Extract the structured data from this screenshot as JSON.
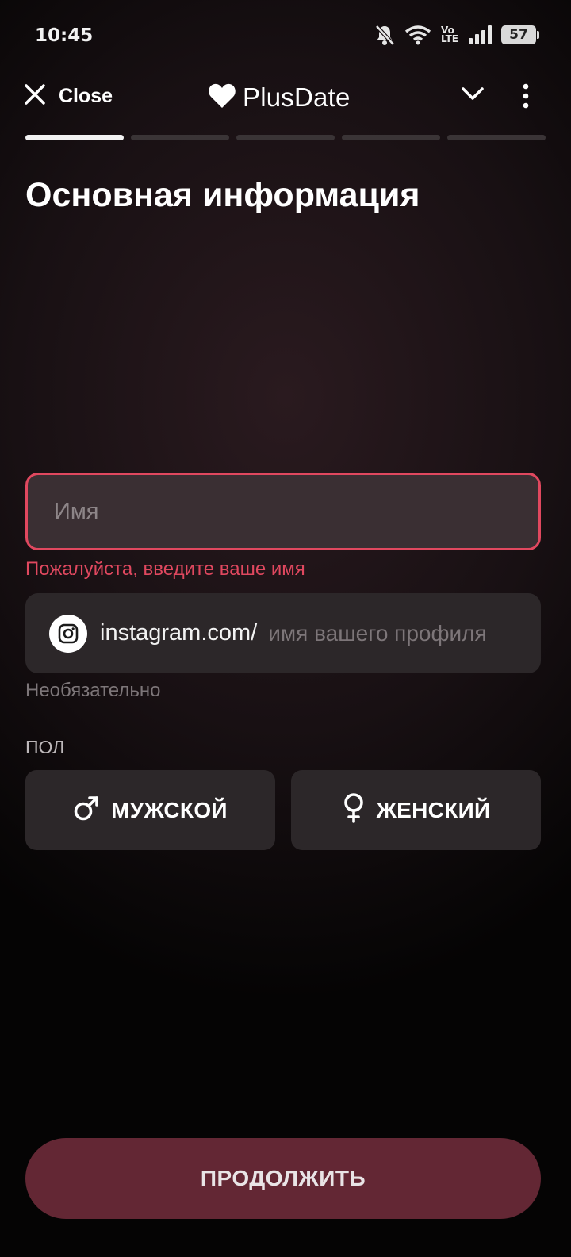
{
  "status_bar": {
    "time": "10:45",
    "icons": [
      "bell-muted-icon",
      "wifi-icon",
      "volte-icon",
      "signal-icon",
      "battery-icon"
    ],
    "volte_line1": "Vo",
    "volte_line2": "LTE",
    "battery_level": "57"
  },
  "nav": {
    "close_label": "Close",
    "brand_name": "PlusDate",
    "icons": {
      "close": "close-icon",
      "brand": "heart-logo-icon",
      "collapse": "chevron-down-icon",
      "menu": "more-vertical-icon"
    }
  },
  "progress": {
    "total_steps": 5,
    "current_step": 1
  },
  "page": {
    "title": "Основная информация"
  },
  "form": {
    "name_placeholder": "Имя",
    "name_value": "",
    "name_error": "Пожалуйста, введите ваше имя",
    "instagram_prefix": "instagram.com/",
    "instagram_placeholder": "имя вашего профиля",
    "instagram_value": "",
    "instagram_hint": "Необязательно",
    "gender_label": "ПОЛ",
    "gender_options": [
      {
        "label": "МУЖСКОЙ",
        "icon": "male-symbol-icon"
      },
      {
        "label": "ЖЕНСКИЙ",
        "icon": "female-symbol-icon"
      }
    ]
  },
  "footer": {
    "continue_label": "ПРОДОЛЖИТЬ"
  },
  "colors": {
    "error": "#e0485f",
    "field_bg": "#2c2729",
    "button_bg": "#632734",
    "progress_active": "#f2f2f2",
    "progress_inactive": "#3a3436"
  }
}
